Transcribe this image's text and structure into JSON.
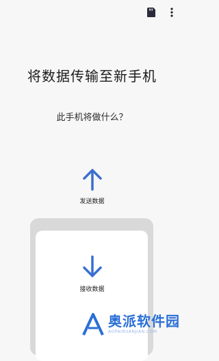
{
  "toolbar": {
    "sd_card_icon": "sd-card-icon",
    "more_icon": "more-vert-icon"
  },
  "main": {
    "title": "将数据传输至新手机",
    "subtitle": "此手机将做什么？"
  },
  "options": {
    "send": {
      "label": "发送数据",
      "icon": "arrow-up-icon"
    },
    "receive": {
      "label": "接收数据",
      "icon": "arrow-down-icon"
    }
  },
  "watermark": {
    "main": "奥派软件园",
    "sub": "AOPAIRUANJIAN.COM"
  },
  "colors": {
    "accent": "#3a6fd0",
    "icon_dark": "#222222",
    "background": "#f7f7f7",
    "phone_frame": "#d9d9d9"
  }
}
